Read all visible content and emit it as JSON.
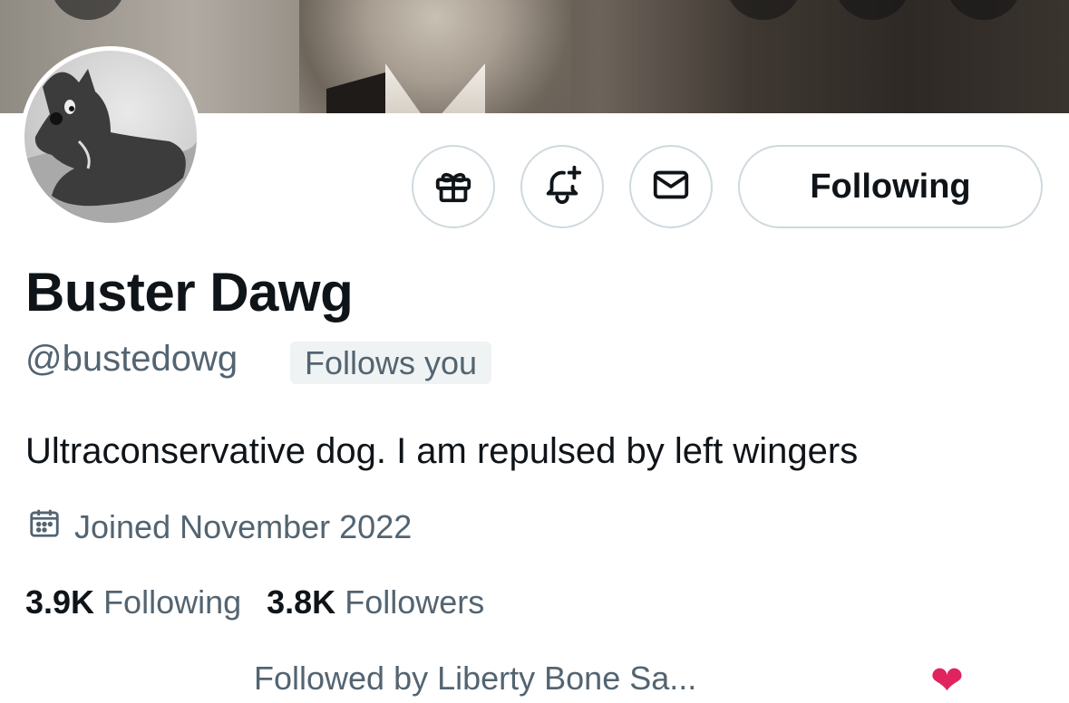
{
  "profile": {
    "display_name": "Buster Dawg",
    "handle": "@bustedowg",
    "follows_you_badge": "Follows you",
    "bio": "Ultraconservative dog. I am repulsed by left wingers",
    "joined": "Joined November 2022",
    "following_count": "3.9K",
    "following_label": "Following",
    "followers_count": "3.8K",
    "followers_label": "Followers",
    "followed_by_partial": "Followed by Liberty Bone Sa..."
  },
  "actions": {
    "follow_state_label": "Following",
    "gift_icon": "gift-icon",
    "notify_icon": "bell-plus-icon",
    "message_icon": "envelope-icon"
  },
  "colors": {
    "primary_text": "#0f1419",
    "secondary_text": "#536471",
    "border": "#cfd9de",
    "badge_bg": "#eff3f4"
  }
}
